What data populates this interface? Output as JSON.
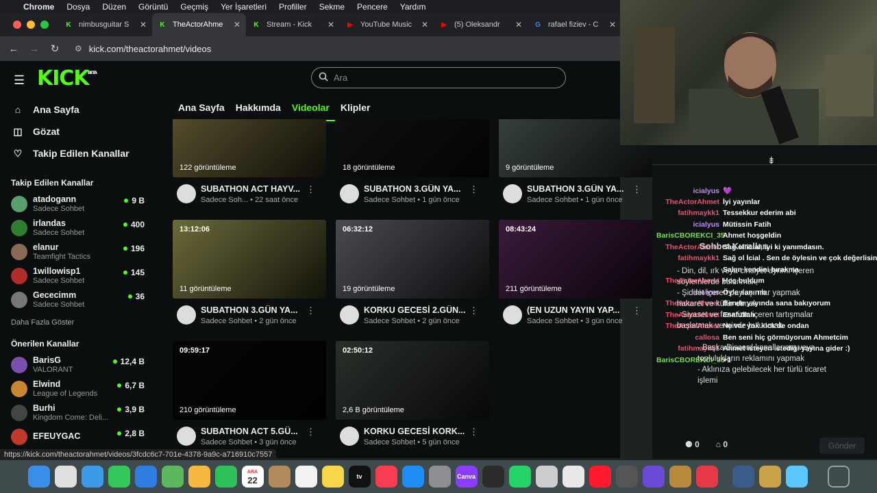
{
  "menubar": {
    "app": "Chrome",
    "items": [
      "Dosya",
      "Düzen",
      "Görüntü",
      "Geçmiş",
      "Yer İşaretleri",
      "Profiller",
      "Sekme",
      "Pencere",
      "Yardım"
    ]
  },
  "tabs": [
    {
      "label": "nimbusguitar S",
      "icon": "kick-icon",
      "color": "#53fc18"
    },
    {
      "label": "TheActorAhme",
      "icon": "kick-icon",
      "color": "#53fc18"
    },
    {
      "label": "Stream - Kick",
      "icon": "kick-icon",
      "color": "#53fc18"
    },
    {
      "label": "YouTube Music",
      "icon": "youtube-music-icon",
      "color": "#ff0000"
    },
    {
      "label": "(5) Oleksandr",
      "icon": "youtube-icon",
      "color": "#ff0000"
    },
    {
      "label": "rafael fiziev - C",
      "icon": "google-icon",
      "color": "#4285f4"
    }
  ],
  "url": "kick.com/theactorahmet/videos",
  "search_placeholder": "Ara",
  "logo": "KICK",
  "logo_sup": "BETA",
  "nav": [
    {
      "label": "Ana Sayfa",
      "icon": "home-icon"
    },
    {
      "label": "Gözat",
      "icon": "browse-icon"
    },
    {
      "label": "Takip Edilen Kanallar",
      "icon": "heart-icon"
    }
  ],
  "followed_title": "Takip Edilen Kanallar",
  "followed": [
    {
      "name": "atadogann",
      "game": "Sadece Sohbet",
      "viewers": "9 B",
      "color": "#5aa06f"
    },
    {
      "name": "irlandas",
      "game": "Sadece Sohbet",
      "viewers": "400",
      "color": "#2e7d32"
    },
    {
      "name": "elanur",
      "game": "Teamfight Tactics",
      "viewers": "196",
      "color": "#8a6a55"
    },
    {
      "name": "1willowisp1",
      "game": "Sadece Sohbet",
      "viewers": "145",
      "color": "#b02d2d"
    },
    {
      "name": "Gececimm",
      "game": "Sadece Sohbet",
      "viewers": "36",
      "color": "#777"
    }
  ],
  "show_more": "Daha Fazla Göster",
  "recommended_title": "Önerilen Kanallar",
  "recommended": [
    {
      "name": "BarisG",
      "game": "VALORANT",
      "viewers": "12,4 B",
      "color": "#7b4fb0"
    },
    {
      "name": "Elwind",
      "game": "League of Legends",
      "viewers": "6,7 B",
      "color": "#c7862f"
    },
    {
      "name": "Burhi",
      "game": "Kingdom Come: Deli...",
      "viewers": "3,9 B",
      "color": "#444"
    },
    {
      "name": "EFEUYGAC",
      "game": "",
      "viewers": "2,8 B",
      "color": "#c0392b"
    }
  ],
  "channel_tabs": [
    "Ana Sayfa",
    "Hakkımda",
    "Videolar",
    "Klipler"
  ],
  "videos": [
    {
      "duration": "",
      "views": "122 görüntüleme",
      "title": "SUBATHON ACT HAYV...",
      "sub": "Sadece Soh... • 22 saat önce",
      "bg": "#5a5230"
    },
    {
      "duration": "",
      "views": "18 görüntüleme",
      "title": "SUBATHON 3.GÜN YA...",
      "sub": "Sadece Sohbet • 1 gün önce",
      "bg": "#111"
    },
    {
      "duration": "",
      "views": "9 görüntüleme",
      "title": "SUBATHON 3.GÜN YA...",
      "sub": "Sadece Sohbet • 1 gün önce",
      "bg": "#3a4540"
    },
    {
      "duration": "13:12:06",
      "views": "11 görüntüleme",
      "title": "SUBATHON 3.GÜN YA...",
      "sub": "Sadece Sohbet • 2 gün önce",
      "bg": "#6b6a3a"
    },
    {
      "duration": "06:32:12",
      "views": "19 görüntüleme",
      "title": "KORKU GECESİ 2.GÜN...",
      "sub": "Sadece Sohbet • 2 gün önce",
      "bg": "#4a4a52"
    },
    {
      "duration": "08:43:24",
      "views": "211 görüntüleme",
      "title": "(EN UZUN YAYIN YAP...",
      "sub": "Sadece Sohbet • 3 gün önce",
      "bg": "#3a1a3a"
    },
    {
      "duration": "09:59:17",
      "views": "210 görüntüleme",
      "title": "SUBATHON ACT 5.GÜ...",
      "sub": "Sadece Sohbet • 3 gün önce",
      "bg": "#050505"
    },
    {
      "duration": "02:50:12",
      "views": "2,6 B görüntüleme",
      "title": "KORKU GECESİ KORK...",
      "sub": "Sadece Sohbet • 5 gün önce",
      "bg": "#2a2f2a"
    }
  ],
  "status_url": "https://kick.com/theactorahmet/videos/3fcdc6c7-701e-4378-9a9c-a716910c7557",
  "chat": [
    {
      "user": "icialyus",
      "text": "💜",
      "color": "#c18cf7"
    },
    {
      "user": "TheActorAhmet",
      "text": "İyi yayınlar",
      "color": "#f0506e"
    },
    {
      "user": "fatihmaykk1",
      "text": "Tessekkur ederim abi",
      "color": "#f0506e"
    },
    {
      "user": "icialyus",
      "text": "Mütissin Fatih",
      "color": "#c18cf7"
    },
    {
      "user": "BarisCBOREKCI_35",
      "text": "Ahmet hoşgeldin",
      "color": "#7ed957"
    },
    {
      "user": "TheActorAhmet",
      "text": "Sağ ol icial, iyi ki yanımdasın.",
      "color": "#f0506e"
    },
    {
      "user": "fatihmaykk1",
      "text": "Sağ ol İcial . Sen de öylesin ve çok değerlisin .",
      "color": "#f0506e"
    },
    {
      "user": "",
      "text": "Sakın kendini bırakma",
      "color": "#f0506e"
    },
    {
      "user": "TheActorAhmet",
      "text": "Hoş buldum",
      "color": "#f0506e"
    },
    {
      "user": "icialyus",
      "text": "Öyle sanırım",
      "color": "#c18cf7"
    },
    {
      "user": "TheActorAhmet",
      "text": "Bende yayında sana bakıyorum",
      "color": "#f0506e"
    },
    {
      "user": "TheActorAhmet",
      "text": "Esafullah",
      "color": "#f0506e"
    },
    {
      "user": "TheActorAhmet",
      "text": "Ne var yok kick'de ondan",
      "color": "#f0506e"
    },
    {
      "user": "callosa",
      "text": "Ben seni hiç görmüyorum Ahmetcim",
      "color": "#f0506e"
    },
    {
      "user": "fatihmaykk1",
      "text": "Ahmet isteyen istediği yayına gider :)",
      "color": "#f0506e"
    },
    {
      "user": "BarisCBOREKCI_35",
      "text": "+1",
      "color": "#7ed957"
    }
  ],
  "rules": {
    "title": "Sohbet Kuralları",
    "lines": [
      "- Din, dil, ırk veya cinsiyet ayrımı içeren",
      "söylemlerde bulunmak,",
      "- Şiddet içeren paylaşımlar yapmak",
      "hakaret ve küfür etmek",
      "- Siyaset ve fanatizm içeren tartışmalar",
      "başlatmak ve içinde bulunmak",
      "",
      "- Başka Discord kanallarının veya",
      "toplulukların reklamını yapmak",
      "- Aklınıza gelebilecek her türlü ticaret",
      "işlemi"
    ]
  },
  "chat_footer": {
    "count1": "0",
    "count2": "0",
    "send": "Gönder"
  },
  "dock": [
    {
      "name": "finder",
      "color": "#3a8ee6"
    },
    {
      "name": "launchpad",
      "color": "#e0e0e0"
    },
    {
      "name": "safari",
      "color": "#3b9be8"
    },
    {
      "name": "messages",
      "color": "#34c759"
    },
    {
      "name": "mail",
      "color": "#2f7de1"
    },
    {
      "name": "maps",
      "color": "#5cb85c"
    },
    {
      "name": "photos",
      "color": "#f5b642"
    },
    {
      "name": "facetime",
      "color": "#30c05a"
    },
    {
      "name": "calendar",
      "color": "#ffffff"
    },
    {
      "name": "contacts",
      "color": "#b08a5a"
    },
    {
      "name": "reminders",
      "color": "#f2f2f2"
    },
    {
      "name": "notes",
      "color": "#f7d64a"
    },
    {
      "name": "tv",
      "color": "#111"
    },
    {
      "name": "music",
      "color": "#fa3c52"
    },
    {
      "name": "appstore",
      "color": "#1f8cf5"
    },
    {
      "name": "settings",
      "color": "#8e8e93"
    },
    {
      "name": "canva",
      "color": "#8b3dff"
    },
    {
      "name": "obs",
      "color": "#2b2b2b"
    },
    {
      "name": "whatsapp",
      "color": "#25d366"
    },
    {
      "name": "disk",
      "color": "#ccc"
    },
    {
      "name": "chrome",
      "color": "#e8e8e8"
    },
    {
      "name": "opera",
      "color": "#ff1b2d"
    },
    {
      "name": "calculator",
      "color": "#555"
    },
    {
      "name": "imovie",
      "color": "#6a4bd8"
    },
    {
      "name": "lol",
      "color": "#b8893a"
    },
    {
      "name": "riot",
      "color": "#e63946"
    },
    {
      "name": "quicktime",
      "color": "#3a5c8a"
    },
    {
      "name": "league",
      "color": "#c9a24a"
    },
    {
      "name": "tasks",
      "color": "#5ac8fa"
    },
    {
      "name": "trash",
      "color": "#9aa0a6"
    }
  ],
  "calendar": {
    "month": "ARA",
    "day": "22"
  },
  "tv_label": "tv",
  "canva_label": "Canva"
}
